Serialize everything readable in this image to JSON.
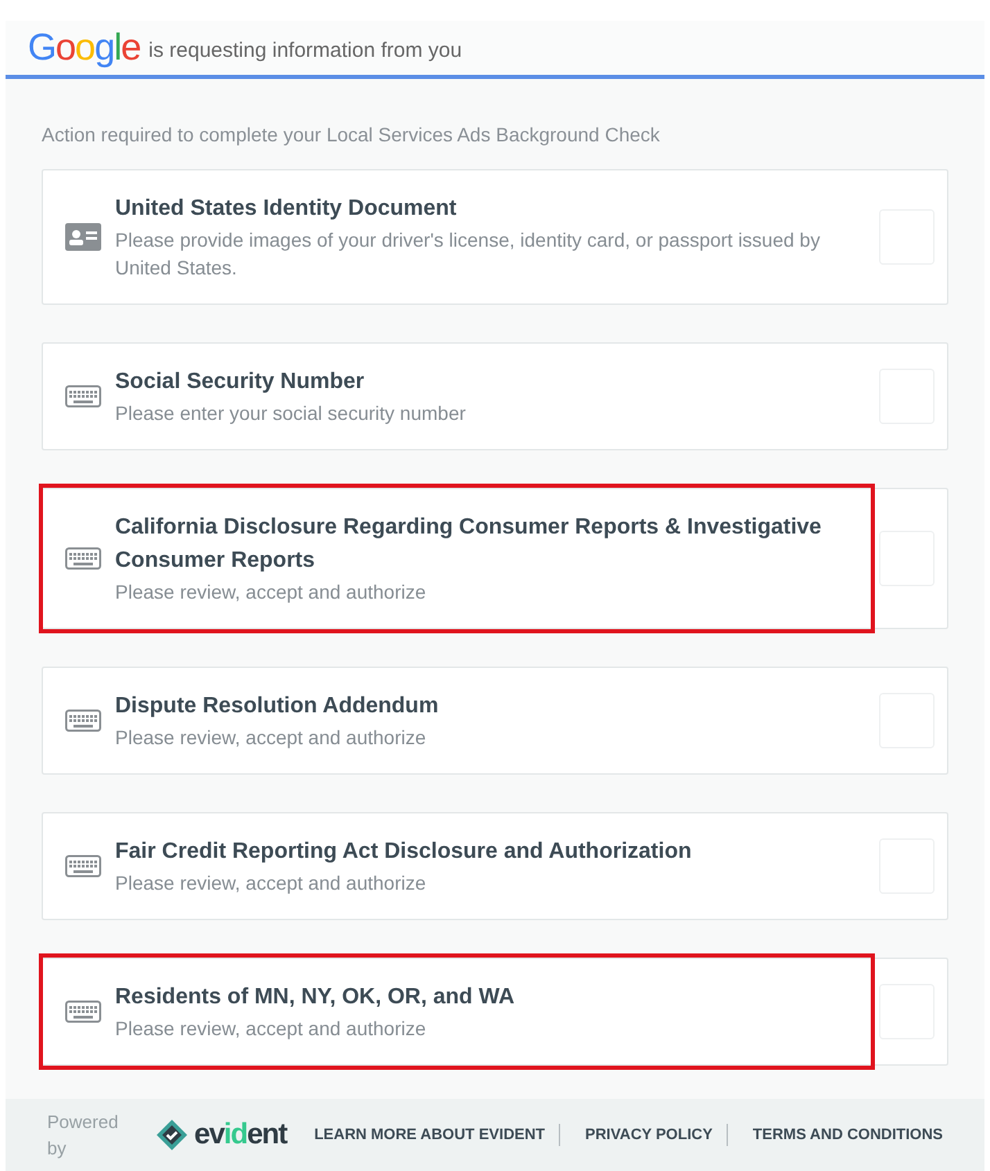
{
  "header": {
    "logo": "Google",
    "text": "is requesting information from you"
  },
  "intro": "Action required to complete your Local Services Ads Background Check",
  "items": [
    {
      "kind": "id",
      "title": "United States Identity Document",
      "description": "Please provide images of your driver's license, identity card, or passport issued by United States.",
      "highlighted": false
    },
    {
      "kind": "keyboard",
      "title": "Social Security Number",
      "description": "Please enter your social security number",
      "highlighted": false
    },
    {
      "kind": "keyboard",
      "title": "California Disclosure Regarding Consumer Reports & Investigative Consumer Reports",
      "description": "Please review, accept and authorize",
      "highlighted": true
    },
    {
      "kind": "keyboard",
      "title": "Dispute Resolution Addendum",
      "description": "Please review, accept and authorize",
      "highlighted": false
    },
    {
      "kind": "keyboard",
      "title": "Fair Credit Reporting Act Disclosure and Authorization",
      "description": "Please review, accept and authorize",
      "highlighted": false
    },
    {
      "kind": "keyboard",
      "title": "Residents of MN, NY, OK, OR, and WA",
      "description": "Please review, accept and authorize",
      "highlighted": true
    }
  ],
  "footer": {
    "powered_by": "Powered by",
    "brand": "evident",
    "links": [
      "LEARN MORE ABOUT EVIDENT",
      "PRIVACY POLICY",
      "TERMS AND CONDITIONS"
    ]
  }
}
